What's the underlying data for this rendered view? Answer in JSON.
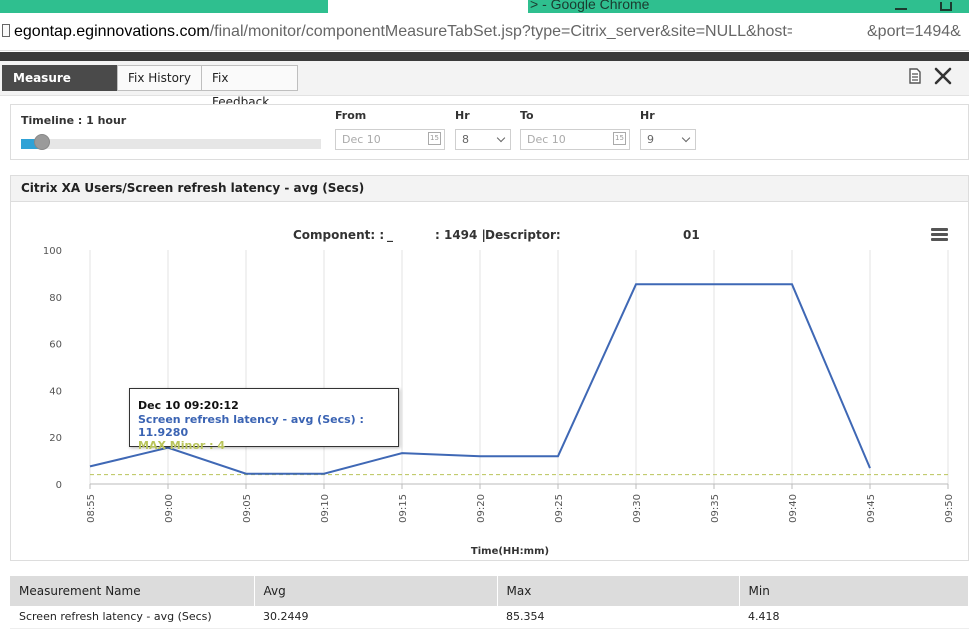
{
  "browser": {
    "window_title_suffix": "> - Google Chrome",
    "url_host": "egontap.eginnovations.com",
    "url_path": "/final/monitor/componentMeasureTabSet.jsp?type=Citrix_server&site=NULL&host=",
    "url_tail": "&port=1494&"
  },
  "toolbar": {
    "tabs": [
      {
        "label": "Measure Graph",
        "active": true
      },
      {
        "label": "Fix History",
        "active": false
      },
      {
        "label": "Fix Feedback",
        "active": false
      }
    ],
    "icons": [
      "report-icon",
      "tools-icon"
    ]
  },
  "timeline": {
    "label": "Timeline : 1 hour",
    "slider_value": 0.07,
    "from_label": "From",
    "from_date": "Dec 10",
    "from_hr_label": "Hr",
    "from_hr": "8",
    "to_label": "To",
    "to_date": "Dec 10",
    "to_hr_label": "Hr",
    "to_hr": "9",
    "calendar_glyph": "15"
  },
  "chart_panel": {
    "header": "Citrix XA Users/Screen refresh latency - avg (Secs)",
    "subtitle_component_label": "Component: :",
    "subtitle_component_value": "_",
    "subtitle_port": ": 1494 |",
    "subtitle_descriptor_label": "Descriptor:",
    "subtitle_descriptor_value": "01"
  },
  "chart_data": {
    "type": "line",
    "x_ticks": [
      "08:55",
      "09:00",
      "09:05",
      "09:10",
      "09:15",
      "09:20",
      "09:25",
      "09:30",
      "09:35",
      "09:40",
      "09:45",
      "09:50"
    ],
    "xlabel": "Time(HH:mm)",
    "ylabel": "",
    "y_ticks": [
      0,
      20,
      40,
      60,
      80,
      100
    ],
    "ylim": [
      0,
      100
    ],
    "xlim": [
      0,
      55
    ],
    "grid": "vertical",
    "series": [
      {
        "name": "Screen refresh latency - avg (Secs)",
        "color": "#3f68b5",
        "points": [
          {
            "x": 0,
            "y": 7.5
          },
          {
            "x": 5,
            "y": 15.5
          },
          {
            "x": 10,
            "y": 4.4
          },
          {
            "x": 15,
            "y": 4.4
          },
          {
            "x": 20,
            "y": 13.2
          },
          {
            "x": 25,
            "y": 11.9
          },
          {
            "x": 30,
            "y": 11.9
          },
          {
            "x": 35,
            "y": 85.35
          },
          {
            "x": 40,
            "y": 85.35
          },
          {
            "x": 45,
            "y": 85.35
          },
          {
            "x": 50,
            "y": 6.8
          }
        ]
      }
    ],
    "threshold": {
      "name": "MAX Minor",
      "value": 4,
      "color": "#b9c45a"
    }
  },
  "tooltip": {
    "date": "Dec 10  09:20:12",
    "series_text": "Screen refresh latency - avg (Secs) : 11.9280",
    "threshold_text": "MAX Minor : 4"
  },
  "summary_table": {
    "headers": [
      "Measurement Name",
      "Avg",
      "Max",
      "Min"
    ],
    "rows": [
      [
        "Screen refresh latency - avg (Secs)",
        "30.2449",
        "85.354",
        "4.418"
      ]
    ]
  }
}
